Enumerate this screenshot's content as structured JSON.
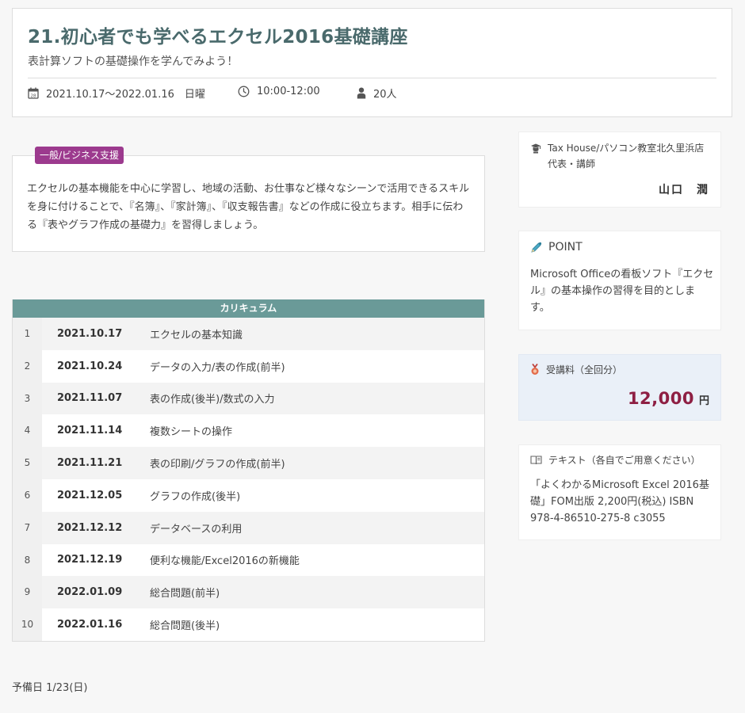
{
  "course": {
    "title": "21.初心者でも学べるエクセル2016基礎講座",
    "subtitle": "表計算ソフトの基礎操作を学んでみよう！",
    "period": "2021.10.17～2022.01.16　日曜",
    "time": "10:00-12:00",
    "capacity": "20人"
  },
  "description": {
    "category": "一般/ビジネス支援",
    "text": "エクセルの基本機能を中心に学習し、地域の活動、お仕事など様々なシーンで活用できるスキルを身に付けることで、『名簿』、『家計簿』、『収支報告書』などの作成に役立ちます。相手に伝わる『表やグラフ作成の基礎力』を習得しましょう。"
  },
  "curriculum": {
    "header": "カリキュラム",
    "rows": [
      {
        "num": "1",
        "date": "2021.10.17",
        "topic": "エクセルの基本知識"
      },
      {
        "num": "2",
        "date": "2021.10.24",
        "topic": "データの入力/表の作成(前半)"
      },
      {
        "num": "3",
        "date": "2021.11.07",
        "topic": "表の作成(後半)/数式の入力"
      },
      {
        "num": "4",
        "date": "2021.11.14",
        "topic": "複数シートの操作"
      },
      {
        "num": "5",
        "date": "2021.11.21",
        "topic": "表の印刷/グラフの作成(前半)"
      },
      {
        "num": "6",
        "date": "2021.12.05",
        "topic": "グラフの作成(後半)"
      },
      {
        "num": "7",
        "date": "2021.12.12",
        "topic": "データベースの利用"
      },
      {
        "num": "8",
        "date": "2021.12.19",
        "topic": "便利な機能/Excel2016の新機能"
      },
      {
        "num": "9",
        "date": "2022.01.09",
        "topic": "総合問題(前半)"
      },
      {
        "num": "10",
        "date": "2022.01.16",
        "topic": "総合問題(後半)"
      }
    ]
  },
  "reserve_day": "予備日 1/23(日)",
  "instructor": {
    "organization": "Tax House/パソコン教室北久里浜店",
    "role": "代表・講師",
    "name": "山口　潤"
  },
  "point": {
    "title": "POINT",
    "text": "Microsoft Officeの看板ソフト『エクセル』の基本操作の習得を目的とします。"
  },
  "fee": {
    "label": "受講料（全回分）",
    "amount": "12,000",
    "unit": "円"
  },
  "textbook": {
    "label": "テキスト（各自でご用意ください）",
    "text": "「よくわかるMicrosoft Excel 2016基礎」FOM出版 2,200円(税込) ISBN 978-4-86510-275-8 c3055"
  },
  "icons": {
    "calendar": "calendar-icon",
    "clock": "clock-icon",
    "person": "person-icon",
    "instructor": "graduation-cap-icon",
    "point": "pencil-icon",
    "fee": "medal-icon",
    "textbook": "book-icon"
  },
  "colors": {
    "title": "#4a6a6c",
    "badge": "#9c3a8e",
    "table_header": "#6a9a98",
    "fee_amount": "#8e1f43",
    "fee_background": "#eaf0f8"
  }
}
